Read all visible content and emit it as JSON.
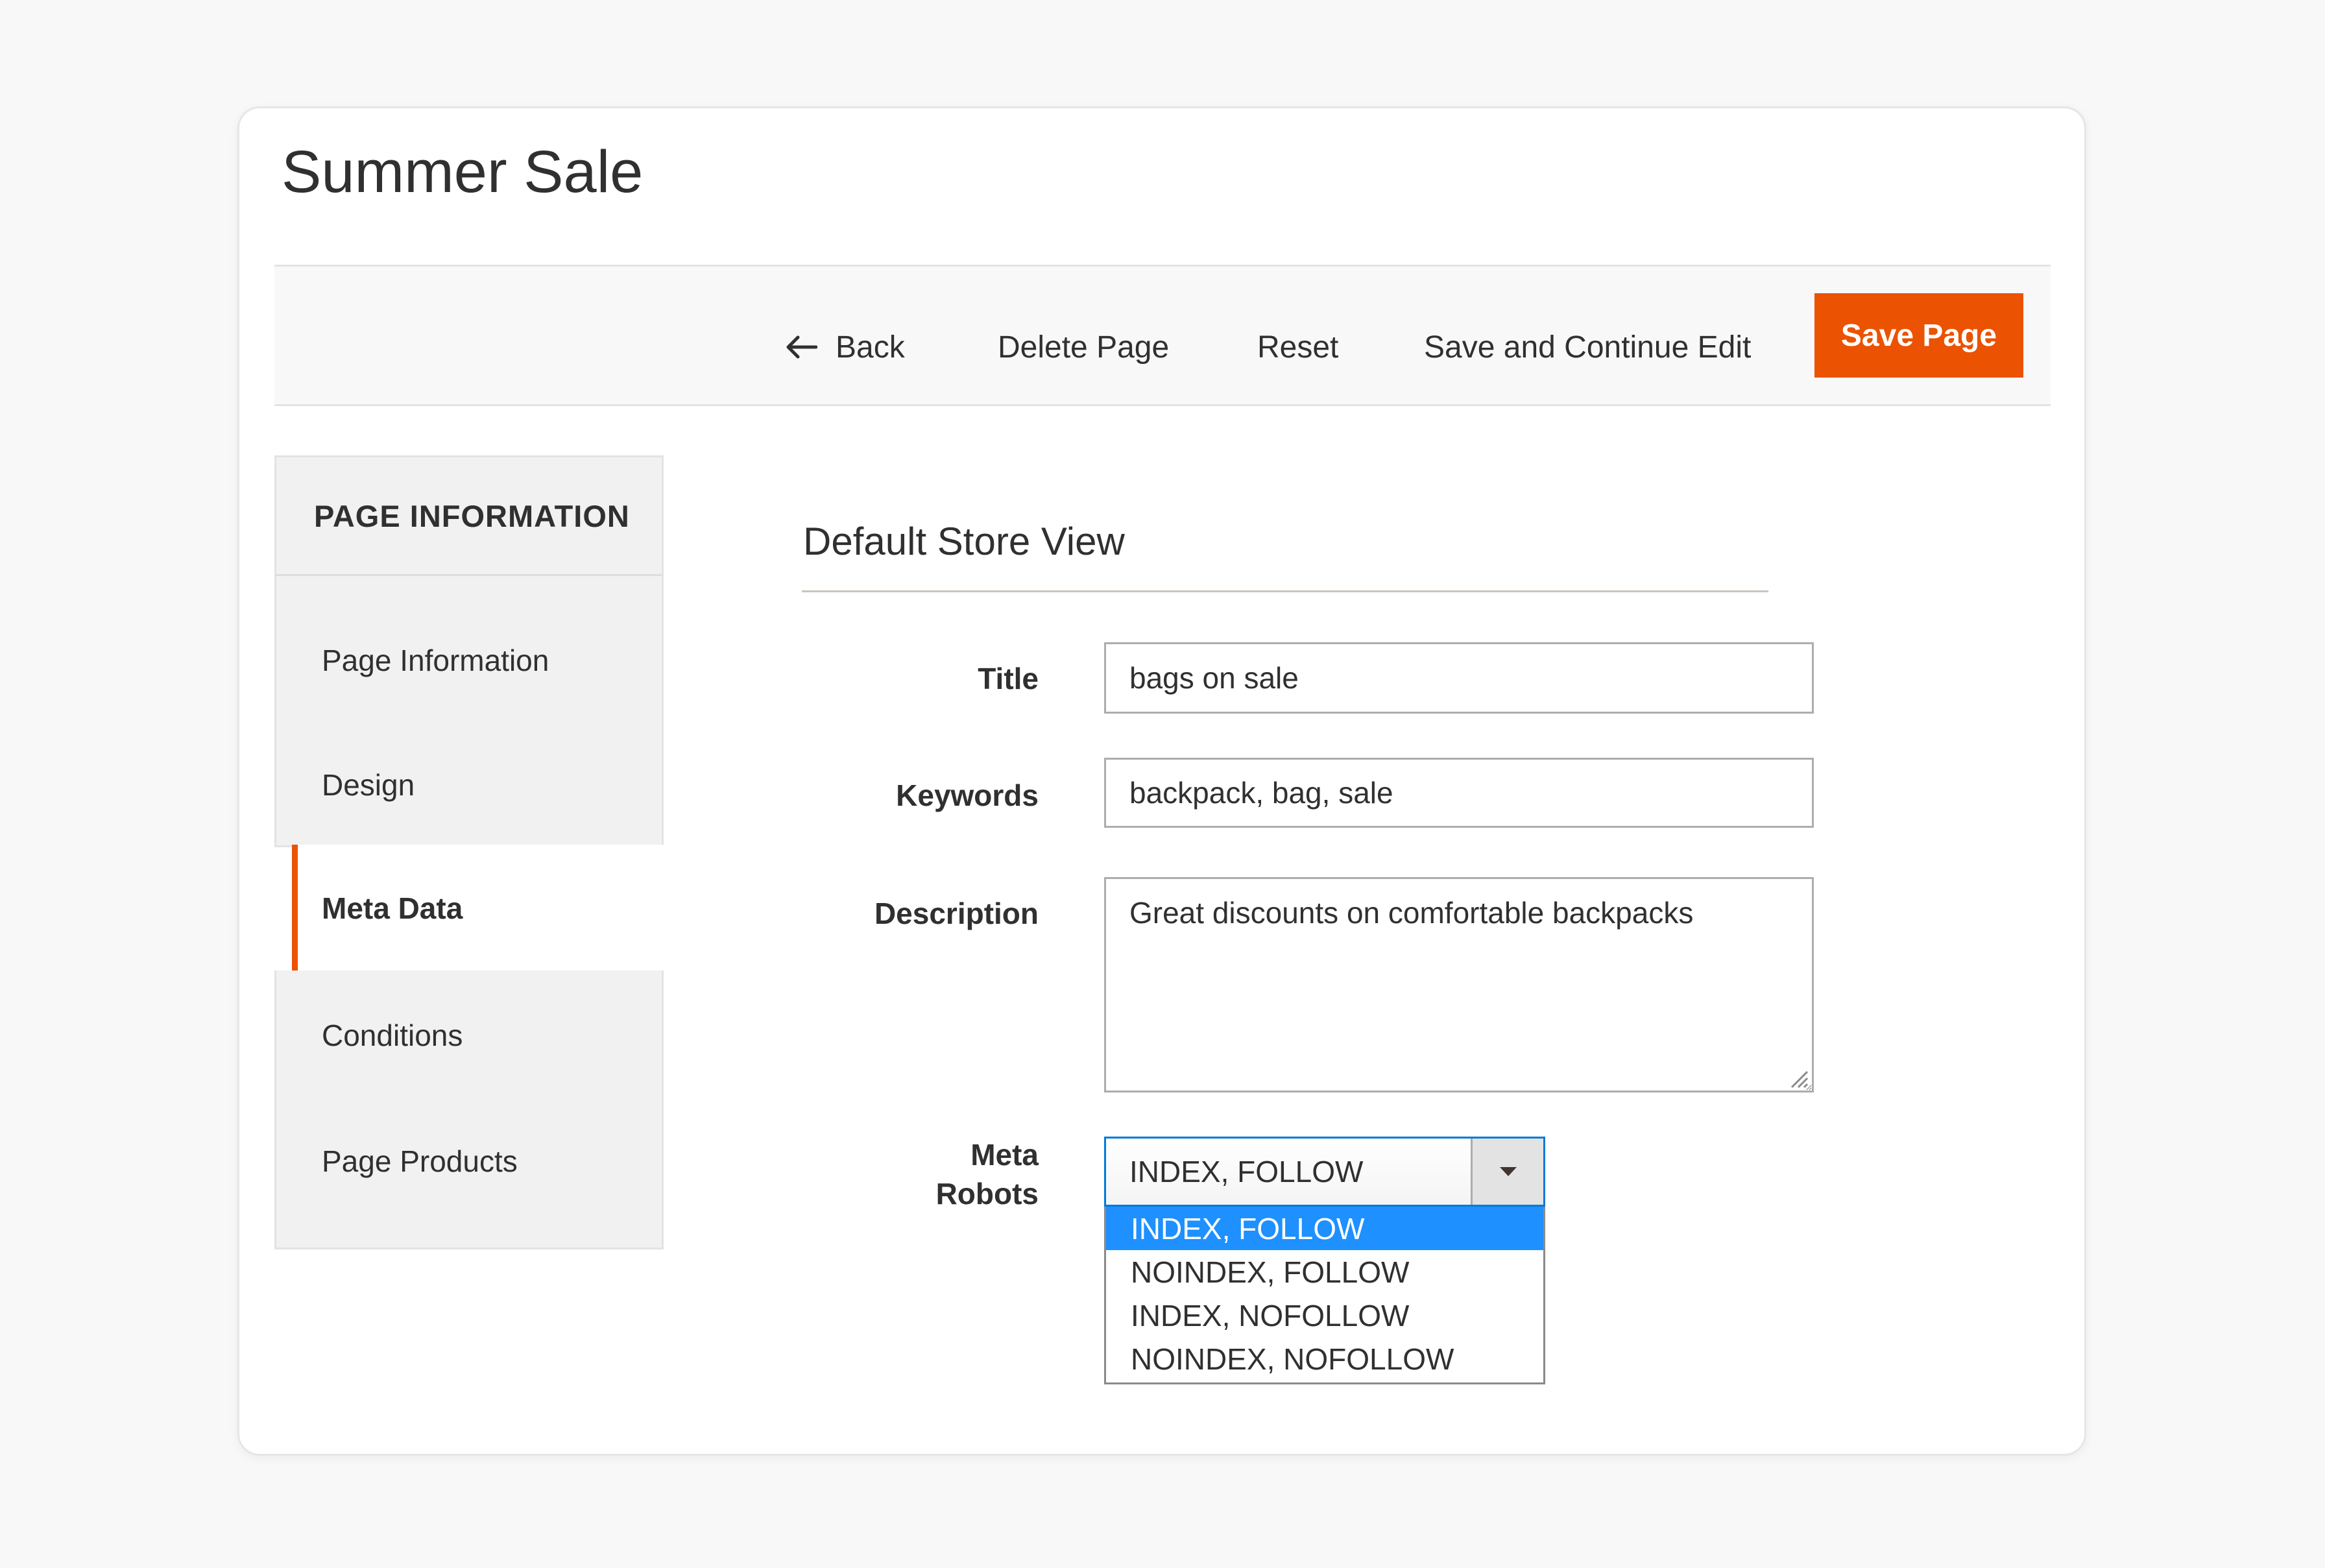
{
  "page": {
    "title": "Summer Sale"
  },
  "toolbar": {
    "back_label": "Back",
    "delete_label": "Delete Page",
    "reset_label": "Reset",
    "save_continue_label": "Save and Continue Edit",
    "save_label": "Save Page"
  },
  "colors": {
    "accent": "#eb5202",
    "focus": "#007bdb",
    "selected_option": "#1e90ff"
  },
  "sidebar": {
    "heading": "PAGE INFORMATION",
    "items": [
      {
        "label": "Page Information"
      },
      {
        "label": "Design"
      },
      {
        "label": "Meta Data",
        "active": true
      },
      {
        "label": "Conditions"
      },
      {
        "label": "Page Products"
      }
    ]
  },
  "form": {
    "section_title": "Default Store View",
    "title": {
      "label": "Title",
      "value": "bags on sale"
    },
    "keywords": {
      "label": "Keywords",
      "value": "backpack, bag, sale"
    },
    "description": {
      "label": "Description",
      "value": "Great discounts on comfortable backpacks"
    },
    "meta_robots": {
      "label_line1": "Meta",
      "label_line2": "Robots",
      "selected": "INDEX, FOLLOW",
      "options": [
        "INDEX, FOLLOW",
        "NOINDEX, FOLLOW",
        "INDEX, NOFOLLOW",
        "NOINDEX, NOFOLLOW"
      ]
    }
  },
  "icons": {
    "back": "arrow-left-icon",
    "dropdown": "caret-down-icon",
    "resize": "resize-grip-icon"
  }
}
